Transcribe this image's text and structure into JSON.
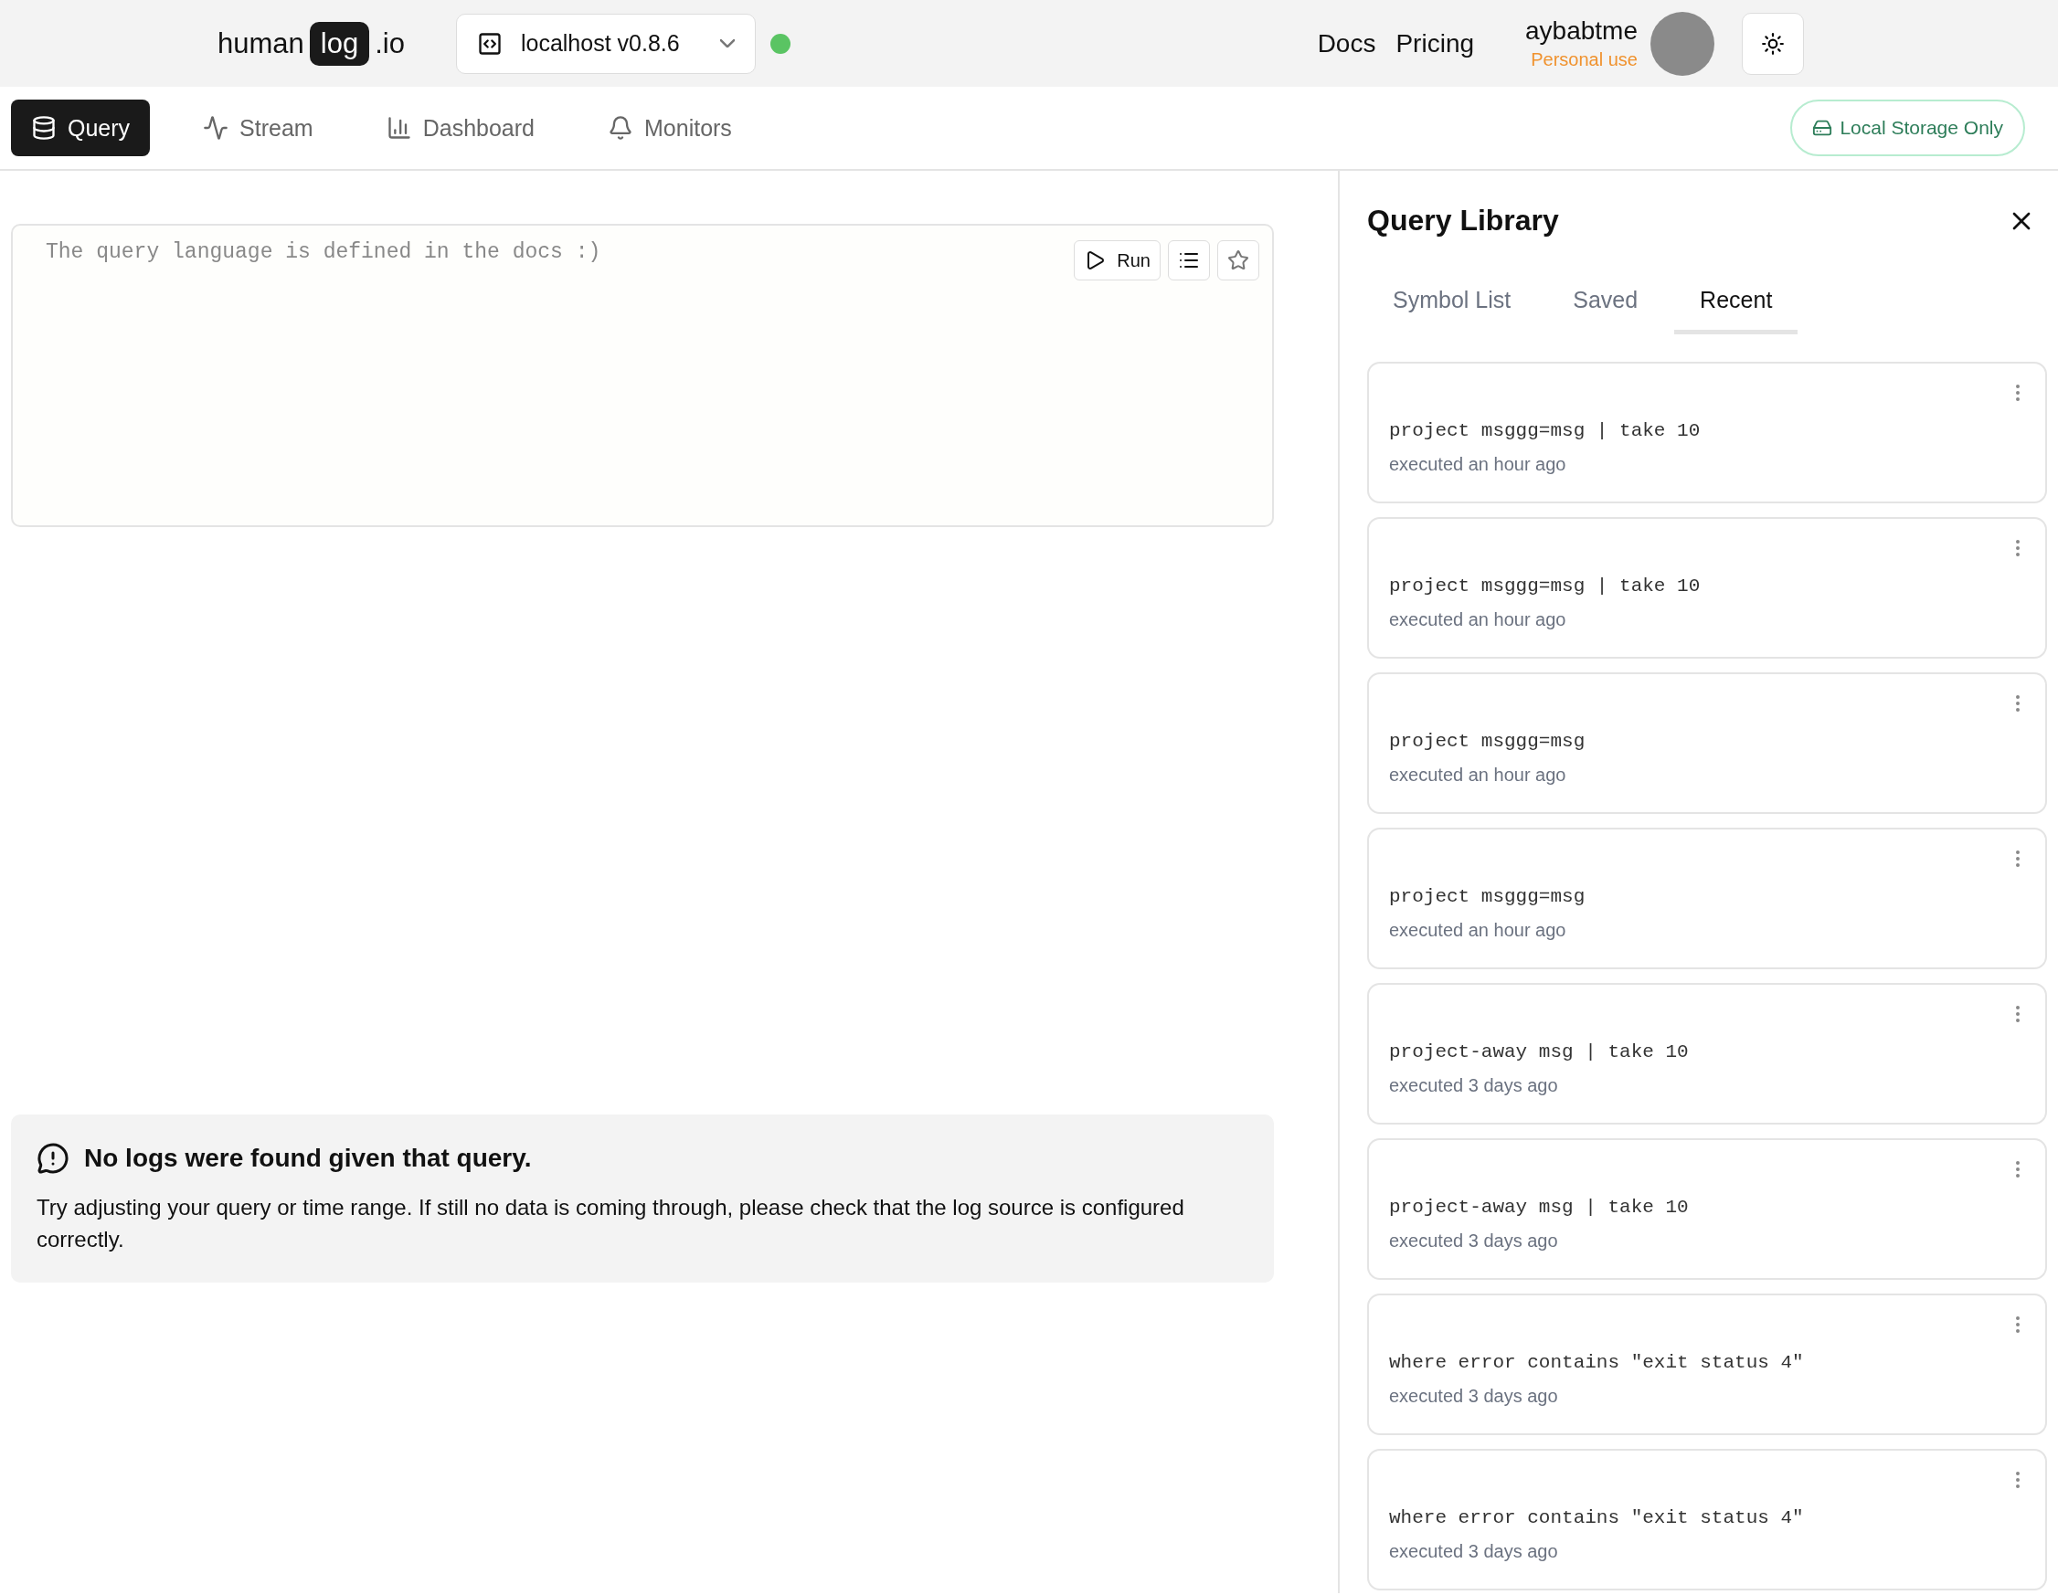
{
  "header": {
    "logo": {
      "before": "human",
      "badge": "log",
      "after": ".io"
    },
    "environment": "localhost v0.8.6",
    "links": [
      "Docs",
      "Pricing"
    ],
    "user": {
      "name": "aybabtme",
      "plan": "Personal use"
    }
  },
  "nav": [
    {
      "label": "Query",
      "selected": true
    },
    {
      "label": "Stream",
      "selected": false
    },
    {
      "label": "Dashboard",
      "selected": false
    },
    {
      "label": "Monitors",
      "selected": false
    }
  ],
  "storage_badge": "Local Storage Only",
  "editor": {
    "placeholder": "The query language is defined in the docs :)",
    "run_label": "Run"
  },
  "empty_state": {
    "title": "No logs were found given that query.",
    "message": "Try adjusting your query or time range. If still no data is coming through, please check that the log source is configured correctly."
  },
  "library": {
    "title": "Query Library",
    "tabs": [
      {
        "label": "Symbol List",
        "selected": false
      },
      {
        "label": "Saved",
        "selected": false
      },
      {
        "label": "Recent",
        "selected": true
      }
    ],
    "items": [
      {
        "query": "project msggg=msg | take 10",
        "time": "executed an hour ago"
      },
      {
        "query": "project msggg=msg | take 10",
        "time": "executed an hour ago"
      },
      {
        "query": "project msggg=msg",
        "time": "executed an hour ago"
      },
      {
        "query": "project msggg=msg",
        "time": "executed an hour ago"
      },
      {
        "query": "project-away msg | take 10",
        "time": "executed 3 days ago"
      },
      {
        "query": "project-away msg | take 10",
        "time": "executed 3 days ago"
      },
      {
        "query": "where error contains \"exit status 4\"",
        "time": "executed 3 days ago"
      },
      {
        "query": "where error contains \"exit status 4\"",
        "time": "executed 3 days ago"
      }
    ]
  }
}
